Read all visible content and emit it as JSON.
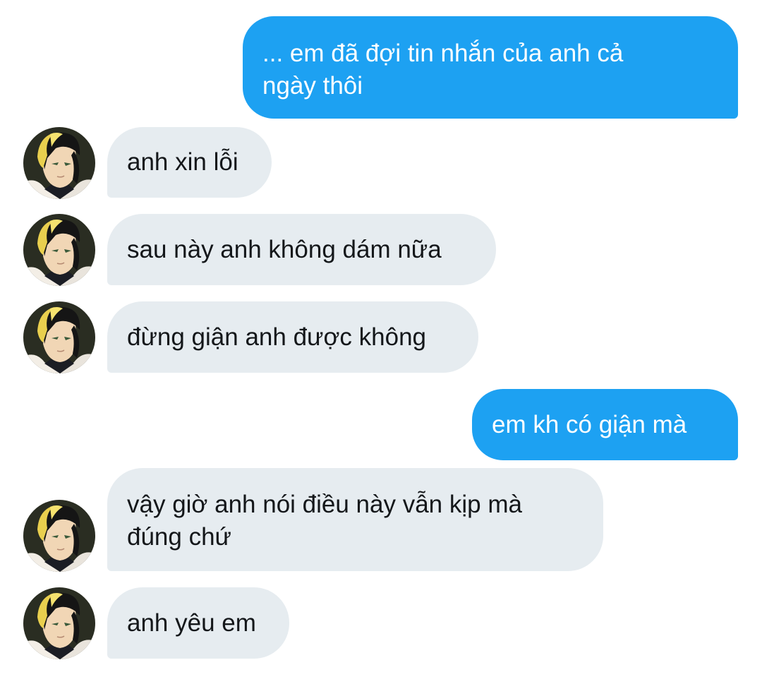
{
  "conversation": {
    "colors": {
      "outgoing_bubble": "#1da1f2",
      "outgoing_text": "#ffffff",
      "incoming_bubble": "#e6ecf0",
      "incoming_text": "#14171a"
    },
    "avatar_icon": "contact-avatar-icon",
    "messages": [
      {
        "sender": "self",
        "text": "... em đã đợi tin nhắn của anh cả\nngày thôi"
      },
      {
        "sender": "contact",
        "text": "anh xin lỗi"
      },
      {
        "sender": "contact",
        "text": "sau này anh không dám nữa"
      },
      {
        "sender": "contact",
        "text": "đừng giận anh được không"
      },
      {
        "sender": "self",
        "text": "em kh có giận mà"
      },
      {
        "sender": "contact",
        "text": "vậy giờ anh nói điều này vẫn kịp mà\nđúng chứ"
      },
      {
        "sender": "contact",
        "text": "anh yêu em"
      }
    ]
  }
}
